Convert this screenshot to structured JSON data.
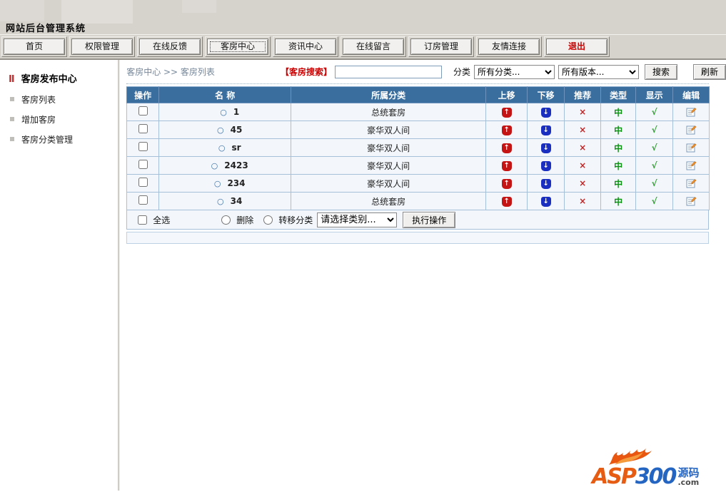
{
  "app": {
    "title": "网站后台管理系统"
  },
  "nav": {
    "tabs": [
      {
        "label": "首页",
        "active": false,
        "danger": false
      },
      {
        "label": "权限管理",
        "active": false,
        "danger": false
      },
      {
        "label": "在线反馈",
        "active": false,
        "danger": false
      },
      {
        "label": "客房中心",
        "active": true,
        "danger": false
      },
      {
        "label": "资讯中心",
        "active": false,
        "danger": false
      },
      {
        "label": "在线留言",
        "active": false,
        "danger": false
      },
      {
        "label": "订房管理",
        "active": false,
        "danger": false
      },
      {
        "label": "友情连接",
        "active": false,
        "danger": false
      },
      {
        "label": "退出",
        "active": false,
        "danger": true
      }
    ]
  },
  "sidebar": {
    "heading_prefix": "Ⅱ",
    "heading": "客房发布中心",
    "items": [
      "客房列表",
      "增加客房",
      "客房分类管理"
    ]
  },
  "toolbar": {
    "breadcrumb": "客房中心 >> 客房列表",
    "search_label": "【客房搜索】",
    "search_value": "",
    "category_label": "分类",
    "category_select": "所有分类...",
    "version_select": "所有版本...",
    "search_button": "搜索",
    "refresh_button": "刷新"
  },
  "table": {
    "headers": [
      "操作",
      "名 称",
      "所属分类",
      "上移",
      "下移",
      "推荐",
      "类型",
      "显示",
      "编辑"
    ],
    "rows": [
      {
        "name": "1",
        "category": "总统套房"
      },
      {
        "name": "45",
        "category": "豪华双人间"
      },
      {
        "name": "sr",
        "category": "豪华双人间"
      },
      {
        "name": "2423",
        "category": "豪华双人间"
      },
      {
        "name": "234",
        "category": "豪华双人间"
      },
      {
        "name": "34",
        "category": "总统套房"
      }
    ],
    "icons": {
      "bullet": "○",
      "up": "↑",
      "down": "↓",
      "recommend": "×",
      "type": "中",
      "display": "√"
    }
  },
  "actions": {
    "select_all": "全选",
    "delete": "删除",
    "transfer": "转移分类",
    "category_select": "请选择类别...",
    "execute": "执行操作"
  },
  "logo": {
    "asp": "ASP",
    "num": "300",
    "cn": "源码",
    "com": ".com"
  },
  "colors": {
    "header_blue": "#3a6e9f",
    "cell_border": "#a6c0da",
    "row_bg": "#f3f7fb",
    "chrome_gray": "#d6d3cd",
    "danger_red": "#cc0000",
    "badge_up": "#c41414",
    "badge_down": "#1a2fc0",
    "icon_green": "#0b9110",
    "logo_orange": "#e65c12",
    "logo_blue": "#2565c2"
  }
}
